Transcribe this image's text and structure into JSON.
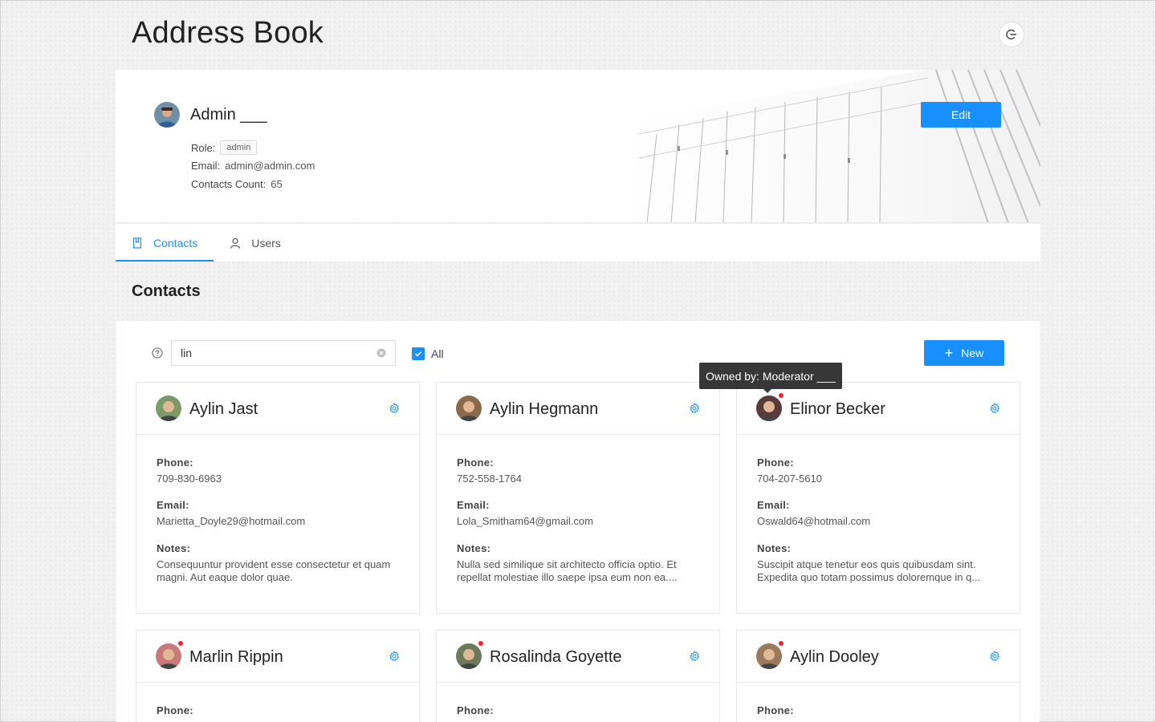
{
  "app": {
    "title": "Address Book"
  },
  "profile": {
    "name": "Admin ___",
    "role_label": "Role:",
    "role": "admin",
    "email_label": "Email:",
    "email": "admin@admin.com",
    "count_label": "Contacts Count:",
    "count": "65",
    "edit_label": "Edit"
  },
  "tabs": [
    {
      "label": "Contacts",
      "icon": "book-icon",
      "active": true
    },
    {
      "label": "Users",
      "icon": "user-icon",
      "active": false
    }
  ],
  "contacts_section": {
    "title": "Contacts",
    "search_value": "lin",
    "all_label": "All",
    "all_checked": true,
    "new_label": "New",
    "tooltip": "Owned by: Moderator ___"
  },
  "labels": {
    "phone": "Phone:",
    "email": "Email:",
    "notes": "Notes:"
  },
  "contacts": [
    {
      "name": "Aylin Jast",
      "phone": "709-830-6963",
      "email": "Marietta_Doyle29@hotmail.com",
      "notes": "Consequuntur provident esse consectetur et quam magni. Aut eaque dolor quae.",
      "badge": false,
      "avatar_color": "#7a9a6a"
    },
    {
      "name": "Aylin Hegmann",
      "phone": "752-558-1764",
      "email": "Lola_Smitham64@gmail.com",
      "notes": "Nulla sed similique sit architecto officia optio. Et repellat molestiae illo saepe ipsa eum non ea....",
      "badge": false,
      "avatar_color": "#8a6a4a"
    },
    {
      "name": "Elinor Becker",
      "phone": "704-207-5610",
      "email": "Oswald64@hotmail.com",
      "notes": "Suscipit atque tenetur eos quis quibusdam sint. Expedita quo totam possimus doloremque in q...",
      "badge": true,
      "avatar_color": "#5a3a3a"
    },
    {
      "name": "Marlin Rippin",
      "phone": "",
      "email": "",
      "notes": "",
      "badge": true,
      "avatar_color": "#c87a7a"
    },
    {
      "name": "Rosalinda Goyette",
      "phone": "",
      "email": "",
      "notes": "",
      "badge": true,
      "avatar_color": "#6a7a5a"
    },
    {
      "name": "Aylin Dooley",
      "phone": "",
      "email": "",
      "notes": "",
      "badge": true,
      "avatar_color": "#9a7a5a"
    }
  ],
  "colors": {
    "accent": "#1890ff",
    "badge": "#f5222d"
  }
}
